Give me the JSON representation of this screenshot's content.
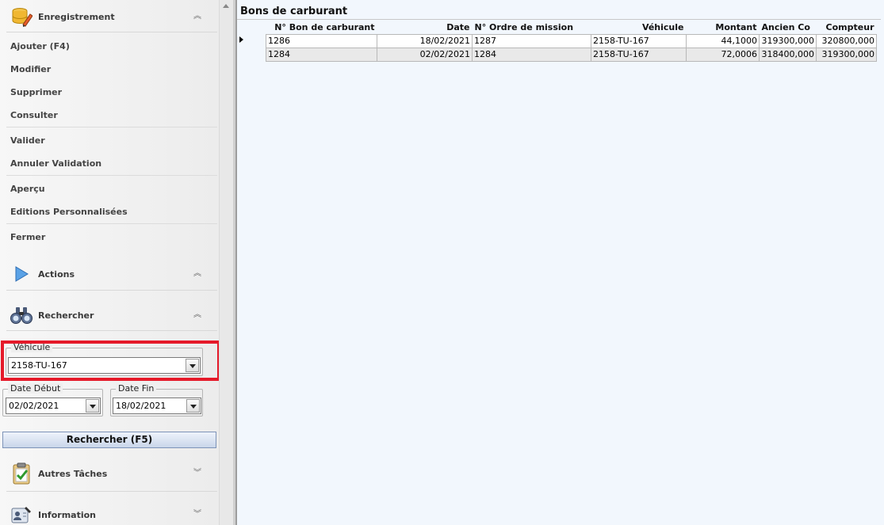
{
  "sidebar": {
    "enregistrement": {
      "title": "Enregistrement",
      "items": {
        "ajouter": "Ajouter (F4)",
        "modifier": "Modifier",
        "supprimer": "Supprimer",
        "consulter": "Consulter",
        "valider": "Valider",
        "annuler": "Annuler Validation",
        "apercu": "Aperçu",
        "editions": "Editions Personnalisées",
        "fermer": "Fermer"
      }
    },
    "actions": {
      "title": "Actions"
    },
    "rechercher": {
      "title": "Rechercher",
      "vehicule_label": "Véhicule",
      "vehicule_value": "2158-TU-167",
      "date_debut_label": "Date Début",
      "date_debut_value": "02/02/2021",
      "date_fin_label": "Date Fin",
      "date_fin_value": "18/02/2021",
      "search_button": "Rechercher (F5)"
    },
    "autres_taches": {
      "title": "Autres Tâches"
    },
    "information": {
      "title": "Information"
    }
  },
  "main": {
    "title": "Bons de carburant",
    "columns": [
      "N° Bon de carburant",
      "Date",
      "N° Ordre de mission",
      "Véhicule",
      "Montant",
      "Ancien Co",
      "Compteur"
    ],
    "rows": [
      [
        "1286",
        "18/02/2021",
        "1287",
        "2158-TU-167",
        "44,1000",
        "319300,000",
        "320800,000"
      ],
      [
        "1284",
        "02/02/2021",
        "1284",
        "2158-TU-167",
        "72,0006",
        "318400,000",
        "319300,000"
      ]
    ]
  },
  "colors": {
    "highlight": "#e51a2a",
    "main_bg": "#f2f7fd"
  }
}
